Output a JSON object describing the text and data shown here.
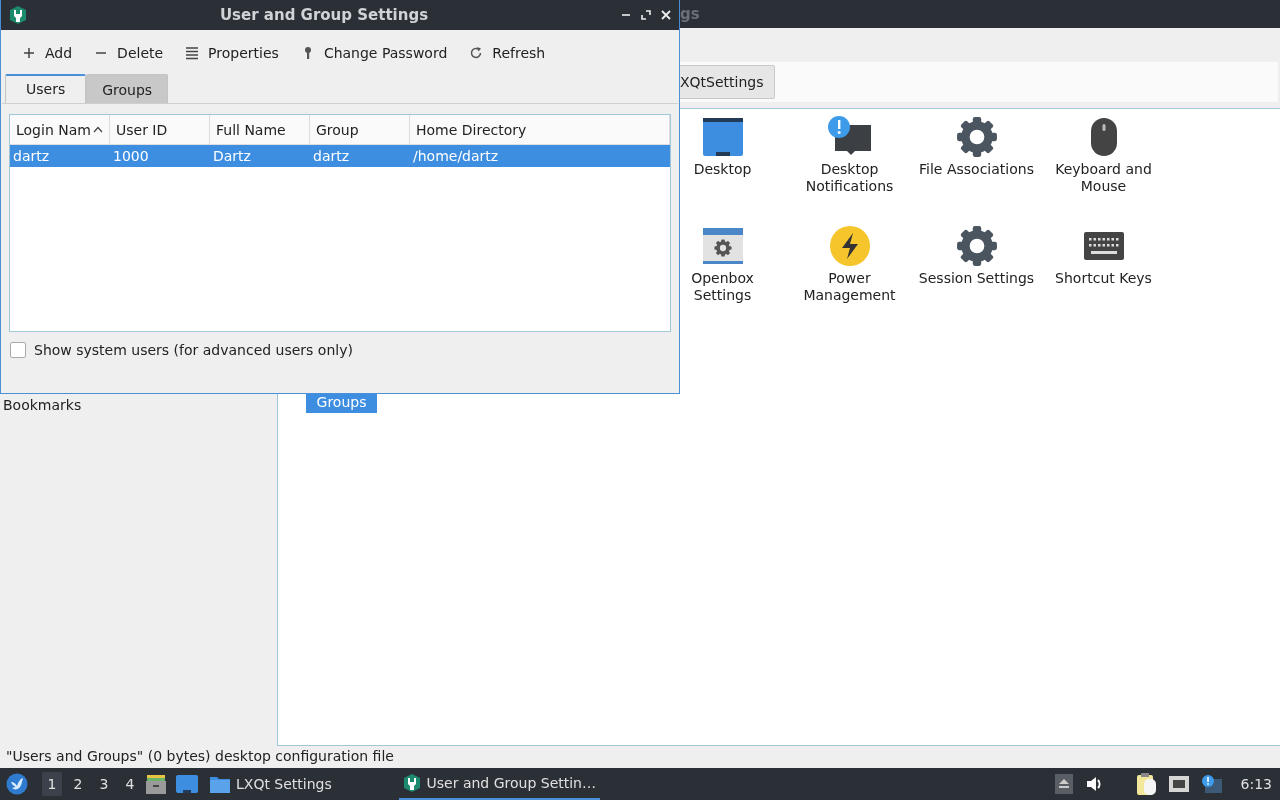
{
  "background_window": {
    "title": "gs",
    "breadcrumb_button": "XQtSettings",
    "sidebar_label": "Bookmarks",
    "items": [
      {
        "label": "Desktop",
        "selected": false
      },
      {
        "label": "Desktop Notifications",
        "selected": false
      },
      {
        "label": "File Associations",
        "selected": false
      },
      {
        "label": "Keyboard and Mouse",
        "selected": false
      },
      {
        "label": "Openbox Settings",
        "selected": false
      },
      {
        "label": "Power Management",
        "selected": false
      },
      {
        "label": "Session Settings",
        "selected": false
      },
      {
        "label": "Shortcut Keys",
        "selected": false
      }
    ],
    "partial_item": {
      "label": "Groups",
      "selected": true
    }
  },
  "dialog": {
    "title": "User and Group Settings",
    "toolbar": [
      {
        "label": "Add"
      },
      {
        "label": "Delete"
      },
      {
        "label": "Properties"
      },
      {
        "label": "Change Password"
      },
      {
        "label": "Refresh"
      }
    ],
    "tabs": [
      {
        "label": "Users",
        "selected": true
      },
      {
        "label": "Groups",
        "selected": false
      }
    ],
    "table": {
      "columns": [
        {
          "label": "Login Nam",
          "sorted": true
        },
        {
          "label": "User ID",
          "sorted": false
        },
        {
          "label": "Full Name",
          "sorted": false
        },
        {
          "label": "Group",
          "sorted": false
        },
        {
          "label": "Home Directory",
          "sorted": false
        }
      ],
      "rows": [
        {
          "cells": [
            "dartz",
            "1000",
            "Dartz",
            "dartz",
            "/home/dartz"
          ],
          "selected": true
        }
      ]
    },
    "show_system_users": {
      "label": "Show system users (for advanced users only)",
      "checked": false
    }
  },
  "status_bar": "\"Users and Groups\" (0 bytes) desktop configuration file",
  "taskbar": {
    "desktops": [
      {
        "label": "1",
        "selected": true
      },
      {
        "label": "2",
        "selected": false
      },
      {
        "label": "3",
        "selected": false
      },
      {
        "label": "4",
        "selected": false
      }
    ],
    "tasks": [
      {
        "label": "LXQt Settings",
        "selected": false
      },
      {
        "label": "User and Group Settin…",
        "selected": true
      }
    ],
    "clock": "6:13"
  }
}
